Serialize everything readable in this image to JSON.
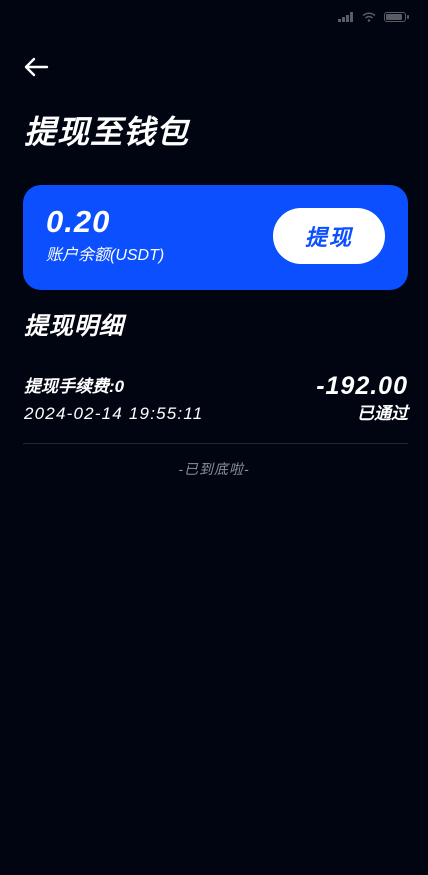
{
  "colors": {
    "background": "#010512",
    "card_blue": "#0b4fff",
    "divider": "#1f2534",
    "muted_text": "#8b909b"
  },
  "status_bar": {
    "battery_icon": "battery-icon",
    "wifi_icon": "wifi-icon",
    "signal_icon": "signal-icon"
  },
  "header": {
    "back_icon": "arrow-left-icon",
    "title": "提现至钱包"
  },
  "balance_card": {
    "amount": "0.20",
    "label": "账户余额(USDT)",
    "withdraw_button": "提现"
  },
  "records_section": {
    "title": "提现明细",
    "records": [
      {
        "fee_label": "提现手续费:0",
        "amount": "-192.00",
        "time": "2024-02-14 19:55:11",
        "status": "已通过"
      }
    ]
  },
  "list_end": "-已到底啦-"
}
